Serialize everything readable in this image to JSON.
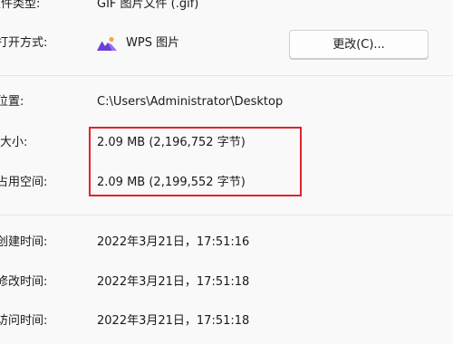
{
  "file_type": {
    "label": "文件类型:",
    "value": "GIF 图片文件 (.gif)"
  },
  "open_with": {
    "label": "打开方式:",
    "app_name": "WPS 图片",
    "app_icon": "wps-picture-icon",
    "change_button_label": "更改(C)..."
  },
  "location": {
    "label": "位置:",
    "value": "C:\\Users\\Administrator\\Desktop"
  },
  "size": {
    "label": "大小:",
    "value": "2.09 MB (2,196,752 字节)"
  },
  "size_on_disk": {
    "label": "占用空间:",
    "value": "2.09 MB (2,199,552 字节)"
  },
  "created": {
    "label": "创建时间:",
    "value": "2022年3月21日，17:51:16"
  },
  "modified": {
    "label": "修改时间:",
    "value": "2022年3月21日，17:51:18"
  },
  "accessed": {
    "label": "访问时间:",
    "value": "2022年3月21日，17:51:18"
  },
  "colors": {
    "highlight": "#e0242b",
    "logo_purple": "#6b3fd6",
    "logo_orange": "#f4a742"
  }
}
